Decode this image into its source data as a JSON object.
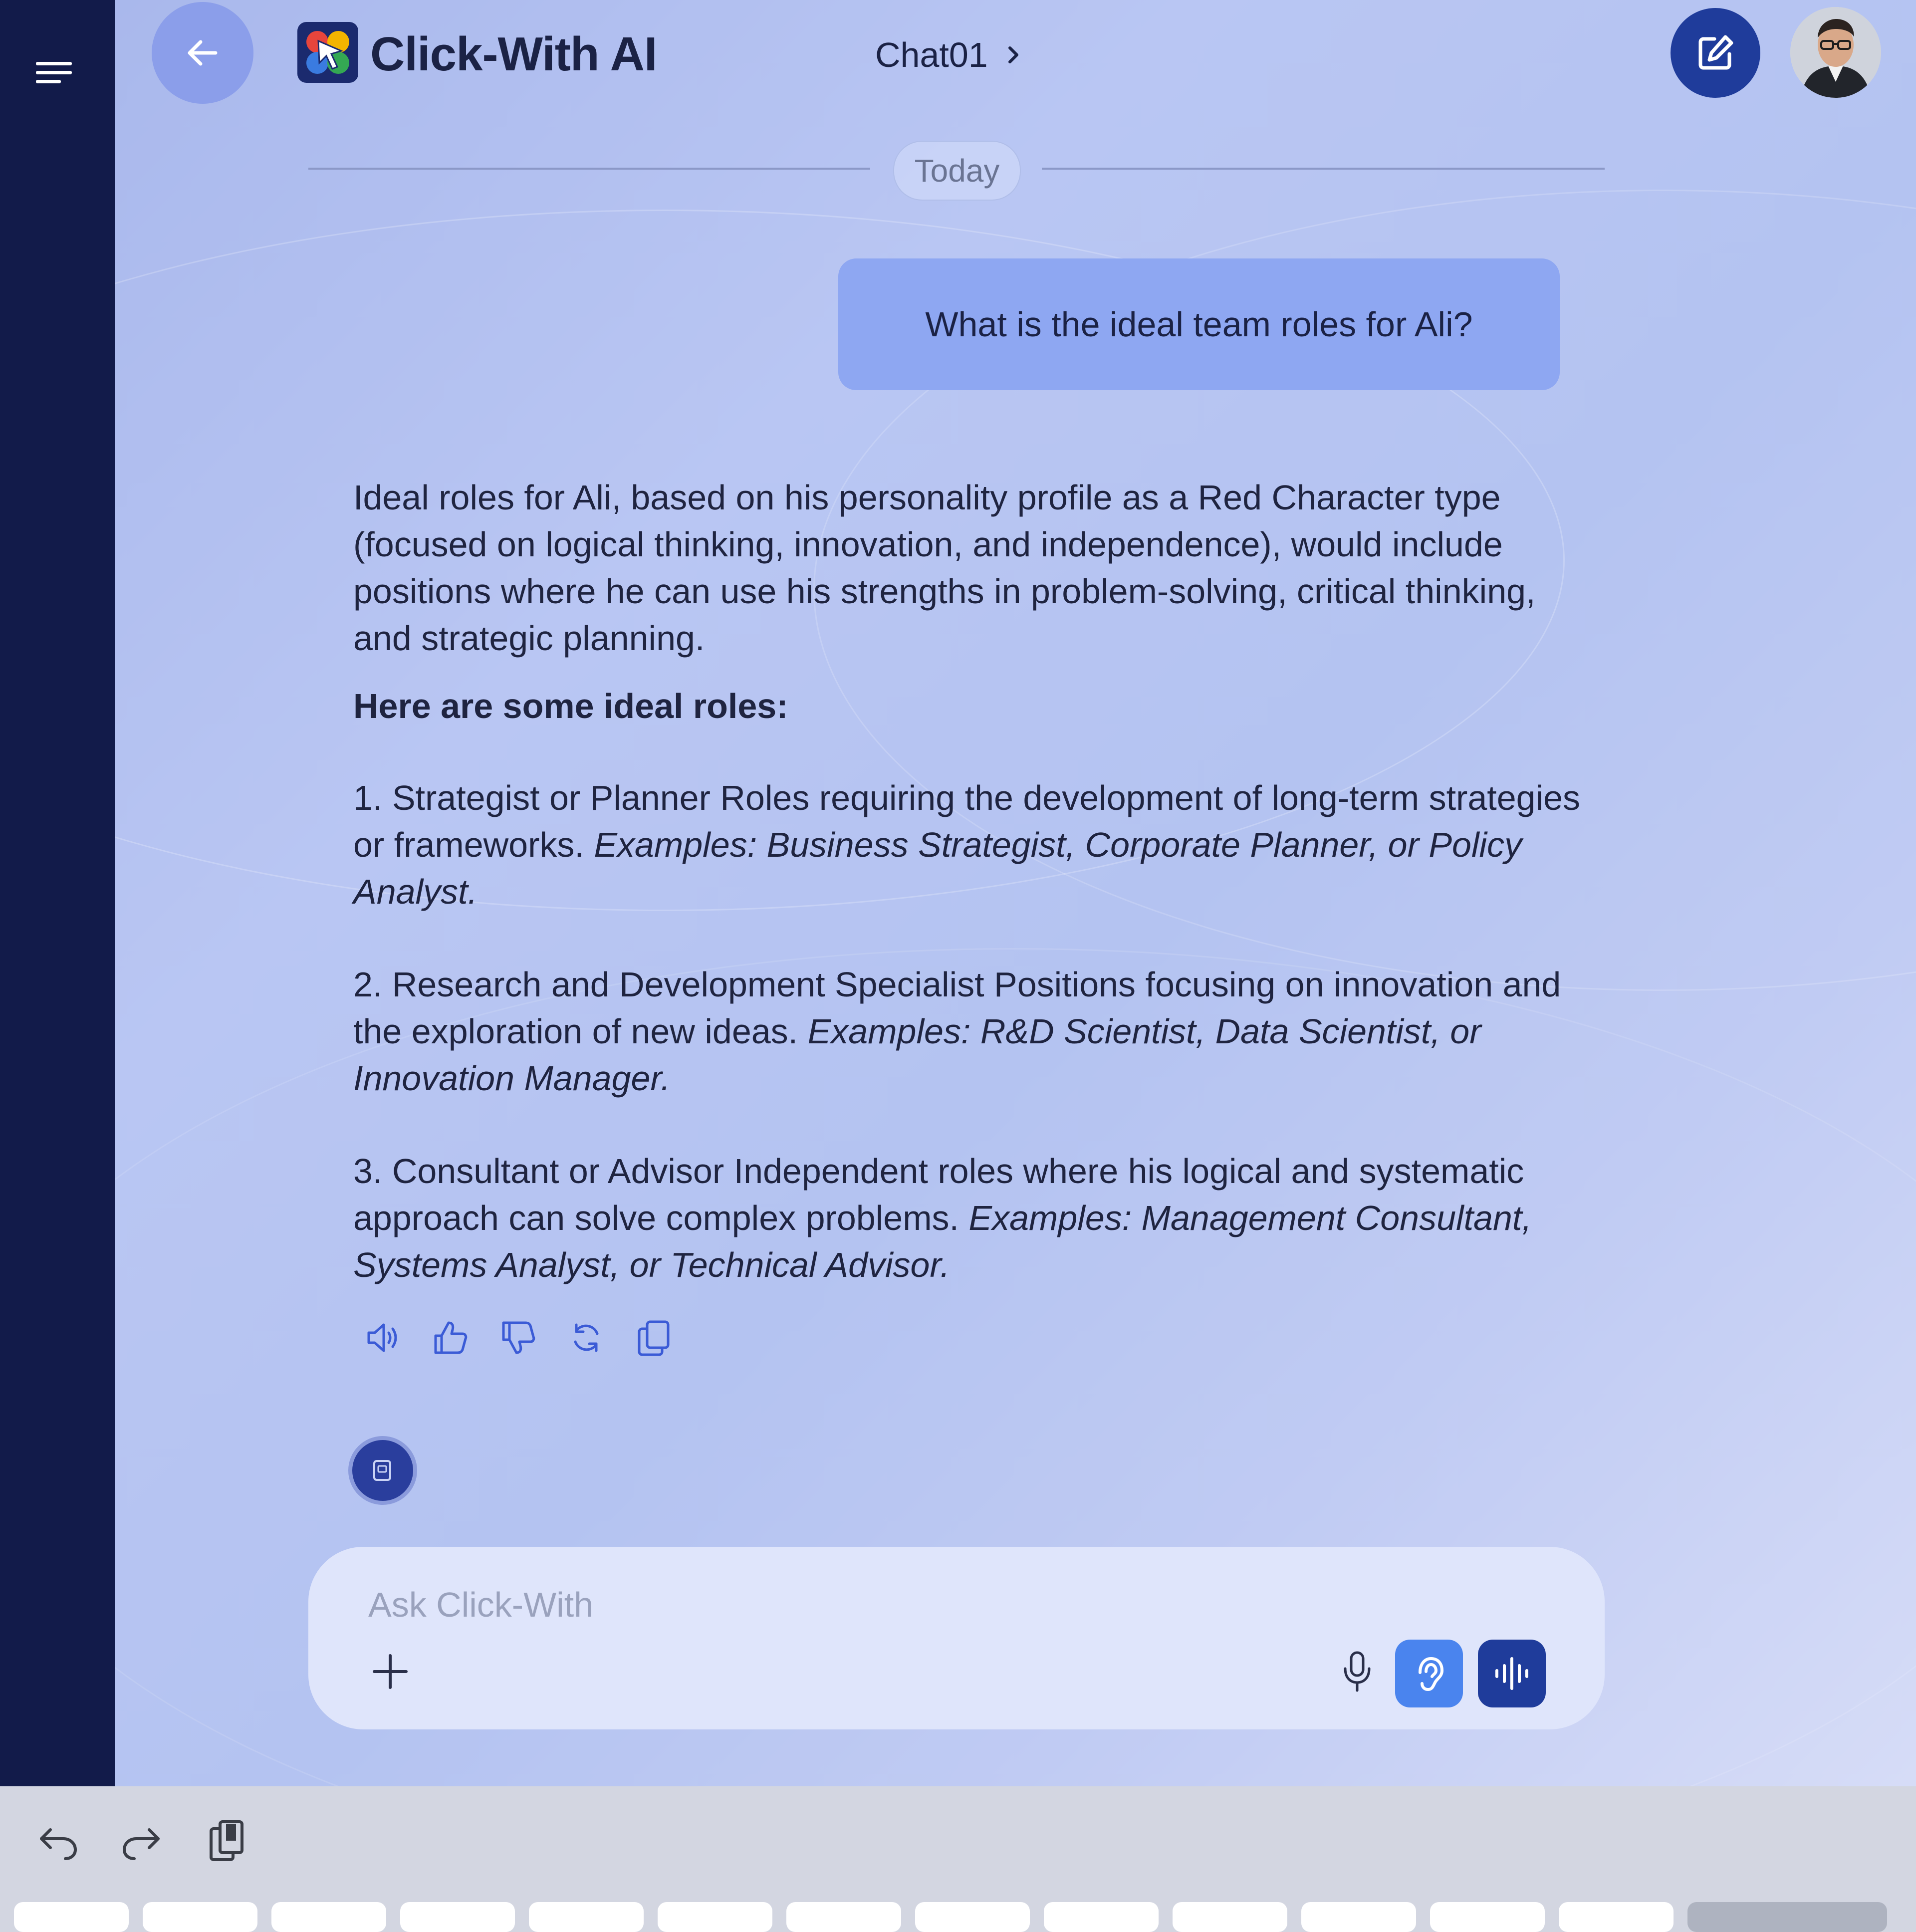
{
  "header": {
    "app_title": "Click-With AI",
    "chat_name": "Chat01"
  },
  "divider": {
    "label": "Today"
  },
  "conversation": {
    "user_message": "What is the ideal team roles for Ali?",
    "answer": {
      "intro": "Ideal roles for Ali, based on his personality profile as a Red Character type (focused on logical thinking, innovation, and independence), would include positions where he can use his strengths in problem-solving, critical thinking, and strategic planning.",
      "heading": "Here are some ideal roles:",
      "roles": [
        {
          "text": "1. Strategist or Planner Roles requiring the development of long-term strategies or frameworks. ",
          "examples": "Examples: Business Strategist, Corporate Planner, or Policy Analyst."
        },
        {
          "text": "2. Research and Development Specialist Positions focusing on innovation and the exploration of new ideas. ",
          "examples": "Examples: R&D Scientist, Data Scientist, or Innovation Manager."
        },
        {
          "text": "3. Consultant or Advisor Independent roles where his logical and systematic approach can solve complex problems. ",
          "examples": "Examples: Management Consultant, Systems Analyst, or Technical Advisor."
        }
      ]
    },
    "actions": [
      "speaker-icon",
      "thumbs-up-icon",
      "thumbs-down-icon",
      "regenerate-icon",
      "copy-icon"
    ]
  },
  "composer": {
    "placeholder": "Ask Click-With"
  },
  "colors": {
    "sidebar": "#121b4a",
    "accent_dark": "#1f3c9b",
    "accent_light": "#4a84ee",
    "user_bubble": "#8ea7f2",
    "back_button": "#8b9eea"
  }
}
